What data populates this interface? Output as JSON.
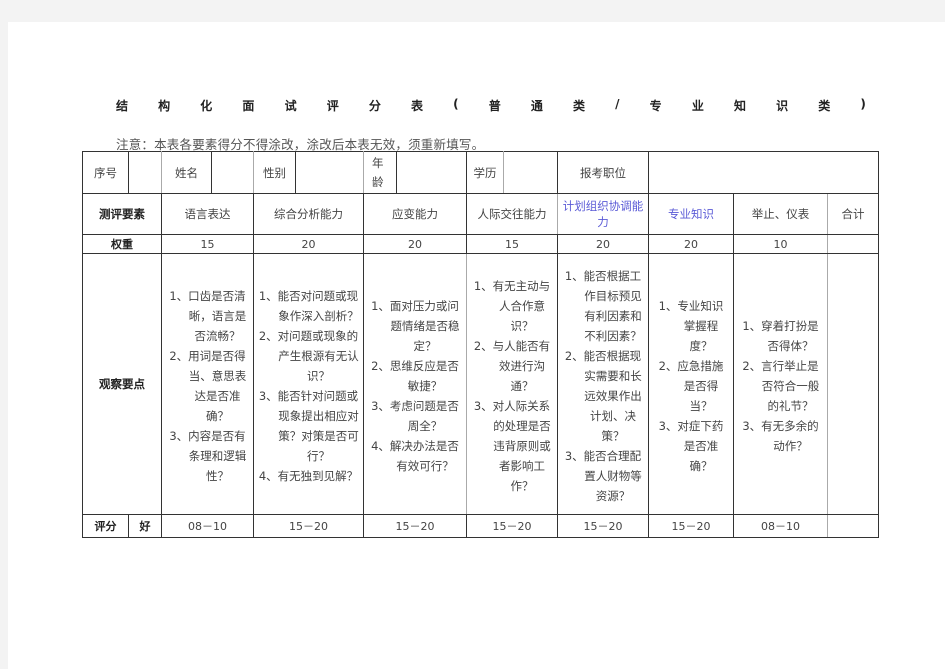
{
  "title_chars": [
    "结",
    "构",
    "化",
    "面",
    "试",
    "评",
    "分",
    "表",
    "(",
    "普",
    "通",
    "类",
    "/",
    "专",
    "业",
    "知",
    "识",
    "类",
    ")"
  ],
  "note": "注意：本表各要素得分不得涂改，涂改后本表无效，须重新填写。",
  "info_row": {
    "seq_label": "序号",
    "seq_value": "",
    "name_label": "姓名",
    "name_value": "",
    "gender_label": "性别",
    "gender_value": "",
    "age_label_1": "年",
    "age_label_2": "龄",
    "age_value": "",
    "edu_label": "学历",
    "edu_value": "",
    "position_label": "报考职位",
    "position_value": ""
  },
  "header_row": {
    "label": "测评要素",
    "factors": [
      "语言表达",
      "综合分析能力",
      "应变能力",
      "人际交往能力",
      "计划组织协调能力",
      "专业知识",
      "举止、仪表"
    ],
    "total_label": "合计"
  },
  "weight_row": {
    "label": "权重",
    "values": [
      "15",
      "20",
      "20",
      "15",
      "20",
      "20",
      "10"
    ],
    "total": ""
  },
  "observation_row": {
    "label": "观察要点",
    "points": [
      [
        "1、口齿是否清晰，语言是否流畅？",
        "2、用词是否得当、意思表达是否准确？",
        "3、内容是否有条理和逻辑性？"
      ],
      [
        "1、能否对问题或现象作深入剖析？",
        "2、对问题或现象的产生根源有无认识？",
        "3、能否针对问题或现象提出相应对策？对策是否可行？",
        "4、有无独到见解？"
      ],
      [
        "1、面对压力或问题情绪是否稳定？",
        "2、思维反应是否敏捷？",
        "3、考虑问题是否周全？",
        "4、解决办法是否有效可行？"
      ],
      [
        "1、有无主动与人合作意识？",
        "2、与人能否有效进行沟通？",
        "3、对人际关系的处理是否违背原则或者影响工作？"
      ],
      [
        "1、能否根据工作目标预见有利因素和不利因素？",
        "2、能否根据现实需要和长远效果作出计划、决策？",
        "3、能否合理配置人财物等资源？"
      ],
      [
        "1、专业知识掌握程度？",
        "2、应急措施是否得当？",
        "3、对症下药是否准确？"
      ],
      [
        "1、穿着打扮是否得体？",
        "2、言行举止是否符合一般的礼节？",
        "3、有无多余的动作？"
      ]
    ]
  },
  "score_row": {
    "label": "评分",
    "grade": "好",
    "ranges": [
      "08－10",
      "15－20",
      "15－20",
      "15－20",
      "15－20",
      "15－20",
      "08－10"
    ],
    "total": ""
  },
  "colors": {
    "highlight_text": "#5b5bd6",
    "border": "#333333",
    "page_bg": "#ffffff",
    "outer_bg": "#f3f3f3"
  }
}
